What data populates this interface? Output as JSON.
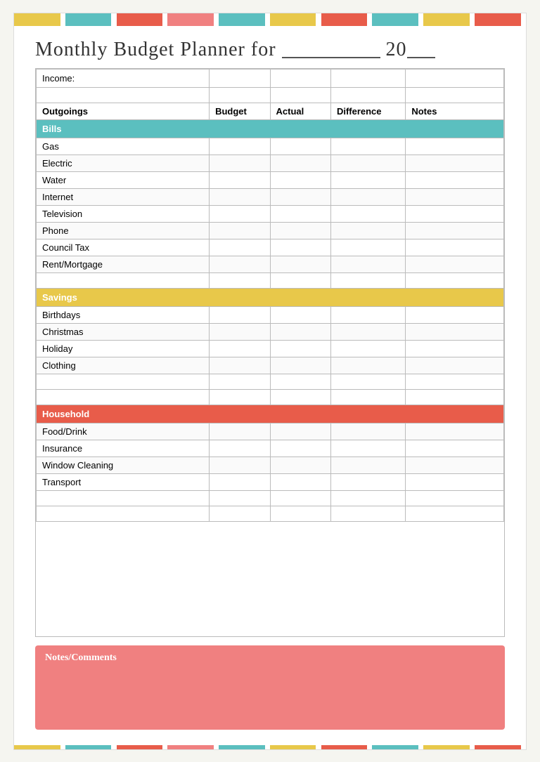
{
  "title": {
    "part1": "Monthly Budget Planner for ",
    "line": "___________",
    "part2": " 20",
    "part3": "__"
  },
  "table": {
    "income_label": "Income:",
    "headers": {
      "outgoings": "Outgoings",
      "budget": "Budget",
      "actual": "Actual",
      "difference": "Difference",
      "notes": "Notes"
    },
    "sections": [
      {
        "name": "Bills",
        "color": "bills",
        "items": [
          "Gas",
          "Electric",
          "Water",
          "Internet",
          "Television",
          "Phone",
          "Council Tax",
          "Rent/Mortgage"
        ]
      },
      {
        "name": "Savings",
        "color": "savings",
        "items": [
          "Birthdays",
          "Christmas",
          "Holiday",
          "Clothing"
        ]
      },
      {
        "name": "Household",
        "color": "household",
        "items": [
          "Food/Drink",
          "Insurance",
          "Window Cleaning",
          "Transport"
        ]
      }
    ]
  },
  "notes_section": {
    "label": "Notes/Comments"
  },
  "deco_bars": {
    "top": [
      "#e8c84a",
      "#5bbfbf",
      "#e85c4a",
      "#f08080",
      "#5bbfbf",
      "#e8c84a",
      "#e85c4a",
      "#5bbfbf",
      "#e8c84a",
      "#f08080",
      "#e85c4a",
      "#5bbfbf"
    ],
    "bottom": [
      "#e8c84a",
      "#5bbfbf",
      "#e85c4a",
      "#f08080",
      "#5bbfbf",
      "#e8c84a",
      "#e85c4a",
      "#5bbfbf",
      "#e8c84a",
      "#f08080",
      "#e85c4a",
      "#5bbfbf"
    ]
  }
}
